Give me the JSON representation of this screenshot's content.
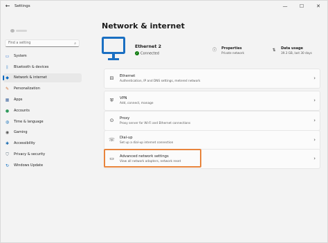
{
  "titlebar": {
    "back_icon": "back-arrow-icon",
    "title": "Settings",
    "minimize_glyph": "—",
    "maximize_glyph": "☐",
    "close_glyph": "✕"
  },
  "search": {
    "placeholder": "Find a setting"
  },
  "sidebar": {
    "items": [
      {
        "label": "System",
        "icon": "system-icon",
        "glyph": "▭",
        "color": "#3a7bd5"
      },
      {
        "label": "Bluetooth & devices",
        "icon": "bluetooth-icon",
        "glyph": "ᛒ",
        "color": "#0067c0"
      },
      {
        "label": "Network & internet",
        "icon": "wifi-icon",
        "glyph": "◆",
        "color": "#0067c0",
        "active": true
      },
      {
        "label": "Personalization",
        "icon": "brush-icon",
        "glyph": "✎",
        "color": "#d36b2b"
      },
      {
        "label": "Apps",
        "icon": "apps-icon",
        "glyph": "▦",
        "color": "#4a6fa5"
      },
      {
        "label": "Accounts",
        "icon": "accounts-icon",
        "glyph": "●",
        "color": "#2f9a5b"
      },
      {
        "label": "Time & language",
        "icon": "globe-icon",
        "glyph": "◍",
        "color": "#2e7fbf"
      },
      {
        "label": "Gaming",
        "icon": "gaming-icon",
        "glyph": "◉",
        "color": "#555555"
      },
      {
        "label": "Accessibility",
        "icon": "accessibility-icon",
        "glyph": "✱",
        "color": "#1f6fb2"
      },
      {
        "label": "Privacy & security",
        "icon": "shield-icon",
        "glyph": "⛉",
        "color": "#5b6b7b"
      },
      {
        "label": "Windows Update",
        "icon": "update-icon",
        "glyph": "↻",
        "color": "#0067c0"
      }
    ]
  },
  "main": {
    "title": "Network & internet",
    "connection": {
      "name": "Ethernet 2",
      "status": "Connected",
      "status_color": "#0f7b0f"
    },
    "properties": {
      "title": "Properties",
      "subtitle": "Private network",
      "icon": "info-icon"
    },
    "data_usage": {
      "title": "Data usage",
      "subtitle": "39.3 GB, last 30 days",
      "icon": "data-usage-icon"
    },
    "cards": [
      {
        "title": "Ethernet",
        "subtitle": "Authentication, IP and DNS settings, metered network",
        "icon": "ethernet-icon",
        "glyph": "⊟"
      },
      {
        "title": "VPN",
        "subtitle": "Add, connect, manage",
        "icon": "vpn-shield-icon",
        "glyph": "⛨"
      },
      {
        "title": "Proxy",
        "subtitle": "Proxy server for Wi-Fi and Ethernet connections",
        "icon": "proxy-icon",
        "glyph": "⊙"
      },
      {
        "title": "Dial-up",
        "subtitle": "Set up a dial-up internet connection",
        "icon": "dial-up-icon",
        "glyph": "☏"
      },
      {
        "title": "Advanced network settings",
        "subtitle": "View all network adapters, network reset",
        "icon": "advanced-network-icon",
        "glyph": "▭"
      }
    ],
    "chevron": "›"
  },
  "colors": {
    "accent": "#0067c0",
    "highlight": "#e8843c",
    "monitor": "#1a6fc2"
  }
}
